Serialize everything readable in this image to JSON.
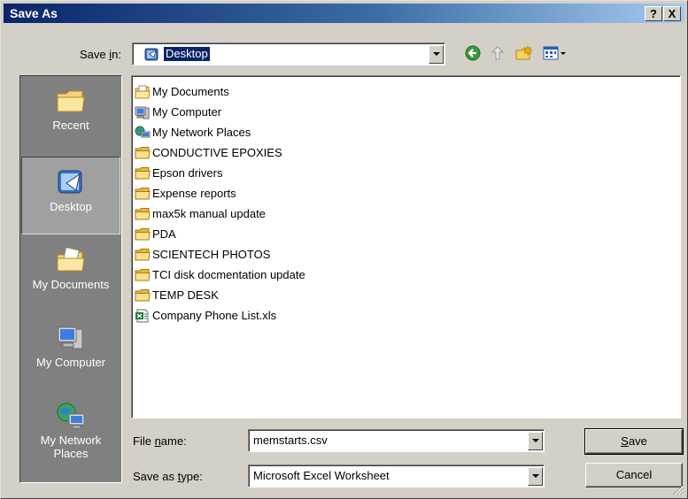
{
  "window": {
    "title": "Save As",
    "help_label": "?",
    "close_label": "X"
  },
  "save_in": {
    "label_prefix": "Save ",
    "label_key": "i",
    "label_suffix": "n:",
    "value": "Desktop"
  },
  "toolbar": {
    "icons": [
      "back-icon",
      "up-folder-icon",
      "new-folder-icon",
      "view-menu-icon"
    ]
  },
  "places": [
    {
      "label": "Recent",
      "icon": "recent-folder-icon",
      "selected": false
    },
    {
      "label": "Desktop",
      "icon": "desktop-icon",
      "selected": true
    },
    {
      "label": "My Documents",
      "icon": "my-documents-icon",
      "selected": false
    },
    {
      "label": "My Computer",
      "icon": "my-computer-icon",
      "selected": false
    },
    {
      "label_line1": "My Network",
      "label_line2": "Places",
      "icon": "network-places-icon",
      "selected": false
    }
  ],
  "files": [
    {
      "name": "My Documents",
      "icon": "my-documents-icon"
    },
    {
      "name": "My Computer",
      "icon": "my-computer-icon"
    },
    {
      "name": "My Network Places",
      "icon": "network-places-icon"
    },
    {
      "name": "CONDUCTIVE EPOXIES",
      "icon": "folder-icon"
    },
    {
      "name": "Epson drivers",
      "icon": "folder-icon"
    },
    {
      "name": "Expense reports",
      "icon": "folder-icon"
    },
    {
      "name": "max5k manual update",
      "icon": "folder-icon"
    },
    {
      "name": "PDA",
      "icon": "folder-icon"
    },
    {
      "name": "SCIENTECH PHOTOS",
      "icon": "folder-icon"
    },
    {
      "name": "TCI disk docmentation update",
      "icon": "folder-icon"
    },
    {
      "name": "TEMP DESK",
      "icon": "folder-icon"
    },
    {
      "name": "Company Phone List.xls",
      "icon": "excel-file-icon"
    }
  ],
  "file_name": {
    "label_prefix": "File ",
    "label_key": "n",
    "label_suffix": "ame:",
    "value": "memstarts.csv"
  },
  "save_type": {
    "label_prefix": "Save as ",
    "label_key": "t",
    "label_suffix": "ype:",
    "value": "Microsoft Excel Worksheet"
  },
  "buttons": {
    "save_key": "S",
    "save_rest": "ave",
    "cancel": "Cancel"
  }
}
